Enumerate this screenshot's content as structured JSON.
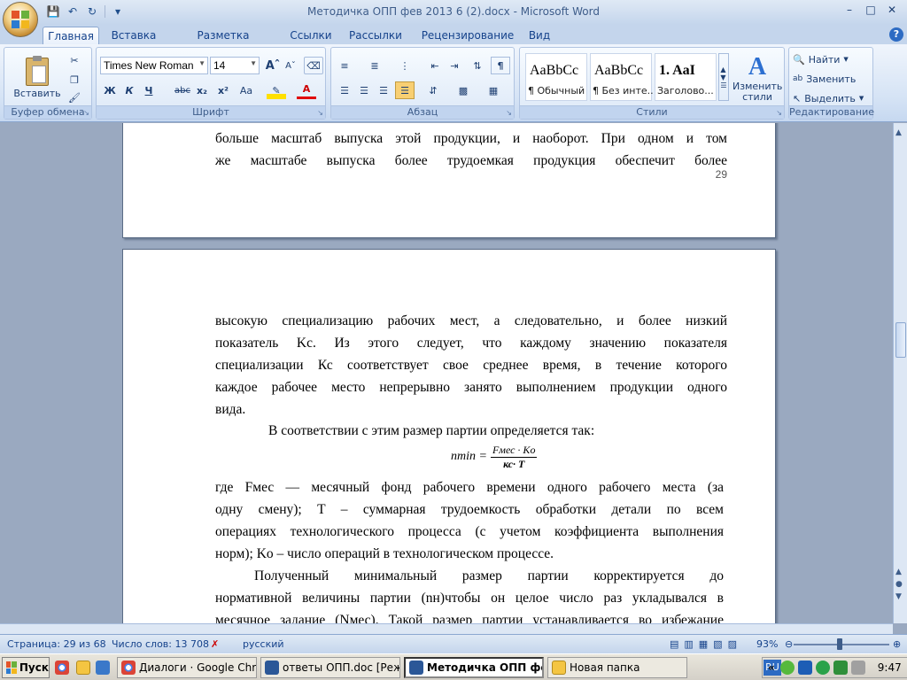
{
  "window": {
    "title": "Методичка ОПП фев 2013 6 (2).docx - Microsoft Word"
  },
  "tabs": [
    {
      "label": "Главная",
      "active": true
    },
    {
      "label": "Вставка"
    },
    {
      "label": "Разметка страницы"
    },
    {
      "label": "Ссылки"
    },
    {
      "label": "Рассылки"
    },
    {
      "label": "Рецензирование"
    },
    {
      "label": "Вид"
    }
  ],
  "ribbon": {
    "clipboard": {
      "label": "Буфер обмена",
      "paste": "Вставить"
    },
    "font": {
      "label": "Шрифт",
      "font_name": "Times New Roman",
      "font_size": "14",
      "bold": "Ж",
      "italic": "К",
      "underline": "Ч",
      "strike": "abc",
      "subscript": "x₂",
      "superscript": "x²",
      "change_case": "Aa"
    },
    "paragraph": {
      "label": "Абзац"
    },
    "styles": {
      "label": "Стили",
      "items": [
        {
          "sample": "AaBbCc",
          "name": "¶ Обычный"
        },
        {
          "sample": "AaBbCc",
          "name": "¶ Без инте..."
        },
        {
          "sample": "1. AaI",
          "name": "Заголово..."
        }
      ],
      "change_styles": "Изменить стили"
    },
    "editing": {
      "label": "Редактирование",
      "find": "Найти",
      "replace": "Заменить",
      "select": "Выделить"
    }
  },
  "document": {
    "page1": {
      "lines": [
        "больше масштаб выпуска этой продукции, и наоборот. При одном и том",
        "же масштабе выпуска более трудоемкая продукция обеспечит более"
      ],
      "page_number": "29"
    },
    "page2": {
      "para1": [
        "высокую специализацию рабочих мест, а следовательно, и более низкий",
        "показатель Kc. Из этого следует, что каждому значению показателя",
        "специализации Кс соответствует свое среднее время, в течение которого",
        "каждое рабочее место непрерывно занято выполнением продукции одного",
        "вида."
      ],
      "para2": "В соответствии с этим размер партии определяется так:",
      "formula": {
        "lhs": "nmin =",
        "numerator": "Fмес · Ko",
        "denominator": "кс· T"
      },
      "para3": [
        "где Fмес — месячный фонд рабочего времени одного рабочего места (за",
        "одну смену); T – суммарная трудоемкость обработки детали по всем",
        "операциях технологического процесса (с учетом коэффициента выполнения",
        "норм); Ko – число операций в технологическом процессе."
      ],
      "para4": [
        "Полученный минимальный размер партии корректируется до",
        "нормативной величины партии (nн)чтобы он целое число раз укладывался в",
        "месячное задание (Nмес). Такой размер партии устанавливается во избежание"
      ]
    }
  },
  "status": {
    "page": "Страница: 29 из 68",
    "words": "Число слов: 13 708",
    "language": "русский",
    "zoom": "93%"
  },
  "taskbar": {
    "start": "Пуск",
    "tasks": [
      {
        "label": "Диалоги · Google Chrome"
      },
      {
        "label": "ответы ОПП.doc [Режи..."
      },
      {
        "label": "Методичка ОПП фе...",
        "active": true
      },
      {
        "label": "Новая папка"
      }
    ],
    "lang": "RU",
    "clock": "9:47"
  }
}
